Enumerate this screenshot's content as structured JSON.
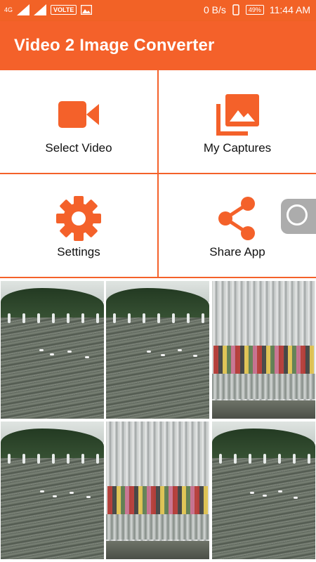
{
  "status_bar": {
    "network": "4G",
    "volte": "VOLTE",
    "speed": "0 B/s",
    "battery": "49%",
    "time": "11:44 AM"
  },
  "app_bar": {
    "title": "Video 2 Image Converter"
  },
  "menu": [
    {
      "label": "Select Video",
      "icon": "video-camera-icon"
    },
    {
      "label": "My Captures",
      "icon": "gallery-icon"
    },
    {
      "label": "Settings",
      "icon": "gear-icon"
    },
    {
      "label": "Share App",
      "icon": "share-icon"
    }
  ],
  "thumbnails": [
    {
      "scene": "lake-with-fountains"
    },
    {
      "scene": "lake-with-fountains"
    },
    {
      "scene": "waterfall-with-people"
    },
    {
      "scene": "lake-with-fountains"
    },
    {
      "scene": "waterfall-with-people"
    },
    {
      "scene": "lake-with-fountains"
    }
  ],
  "colors": {
    "primary": "#f4612a",
    "status_bar": "#f26226",
    "icon": "#f4612a"
  }
}
